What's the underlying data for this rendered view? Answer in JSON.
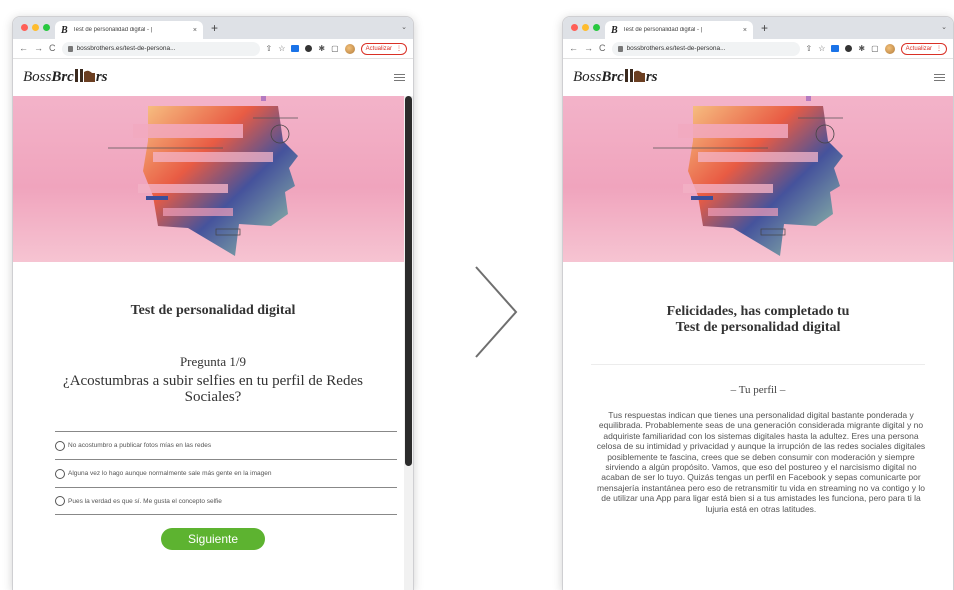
{
  "browser": {
    "tab_title": "Test de personalidad digital - |",
    "tab_favicon": "B",
    "tab_close": "×",
    "new_tab": "+",
    "tab_menu": "⌄",
    "url_left": "bossbrothers.es/test-de-persona...",
    "url_right": "bossbrothers.es/test-de-persona...",
    "update_label": "Actualizar",
    "update_badge": "⋮"
  },
  "site": {
    "logo_prefix": "Boss",
    "logo_bold": "Brc",
    "logo_suffix": "rs"
  },
  "quiz": {
    "title": "Test de personalidad digital",
    "question_number": "Pregunta 1/9",
    "question_text": "¿Acostumbras a subir selfies en tu perfil de Redes Sociales?",
    "options": [
      "No acostumbro a publicar fotos mías en las redes",
      "Alguna vez lo hago aunque normalmente sale más gente en la imagen",
      "Pues la verdad es que sí. Me gusta el concepto selfie"
    ],
    "next_button": "Siguiente"
  },
  "result": {
    "title_line1": "Felicidades, has completado tu",
    "title_line2": "Test de personalidad digital",
    "profile_heading": "– Tu perfil –",
    "profile_text": "Tus respuestas indican que tienes una personalidad digital bastante ponderada y equilibrada. Probablemente seas de una generación considerada migrante digital y no adquiriste familiaridad con los sistemas digitales hasta la adultez. Eres una persona celosa de su intimidad y privacidad y aunque la irrupción de las redes sociales digitales posiblemente te fascina, crees que se deben consumir con moderación y siempre sirviendo a algún propósito. Vamos, que eso del postureo y el narcisismo digital no acaban de ser lo tuyo. Quizás tengas un perfil en Facebook y sepas comunicarte por mensajería instantánea pero eso de retransmitir tu vida en streaming no va contigo y lo de utilizar una App para ligar está bien si a tus amistades les funciona, pero para ti la lujuria está en otras latitudes."
  },
  "colors": {
    "accent_green": "#5db330",
    "update_red": "#d93025",
    "hero_pink": "#f0a4bd"
  },
  "icons": [
    "back-arrow-icon",
    "forward-arrow-icon",
    "reload-icon",
    "lock-icon",
    "share-icon",
    "star-icon",
    "extension-icon",
    "puzzle-icon",
    "sidebar-icon",
    "hamburger-menu-icon",
    "chevron-right-icon"
  ]
}
